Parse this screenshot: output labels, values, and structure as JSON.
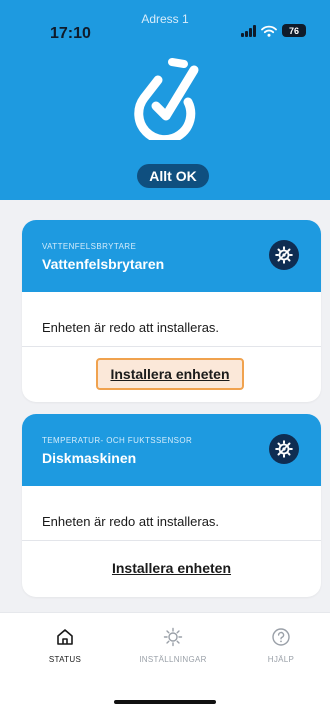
{
  "status_bar": {
    "time": "17:10",
    "carrier": "Adress 1",
    "battery": "76"
  },
  "header": {
    "status_label": "Allt OK"
  },
  "devices": [
    {
      "type_label": "VATTENFELSBRYTARE",
      "name": "Vattenfelsbrytaren",
      "message": "Enheten är redo att installeras.",
      "action_label": "Installera enheten",
      "icon": "gear-icon"
    },
    {
      "type_label": "TEMPERATUR- OCH FUKTSSENSOR",
      "name": "Diskmaskinen",
      "message": "Enheten är redo att installeras.",
      "action_label": "Installera enheten",
      "icon": "gear-icon"
    }
  ],
  "tabs": [
    {
      "label": "STATUS",
      "icon": "home-icon",
      "active": true
    },
    {
      "label": "INSTÄLLNINGAR",
      "icon": "sun-gear-icon",
      "active": false
    },
    {
      "label": "HJÄLP",
      "icon": "help-icon",
      "active": false
    }
  ],
  "colors": {
    "brand_blue": "#1e9ae0",
    "dark_navy": "#0f2d52",
    "pill_navy": "#0f4f7f",
    "focus_orange": "#f0a24e",
    "focus_fill": "#fbe8d9"
  }
}
